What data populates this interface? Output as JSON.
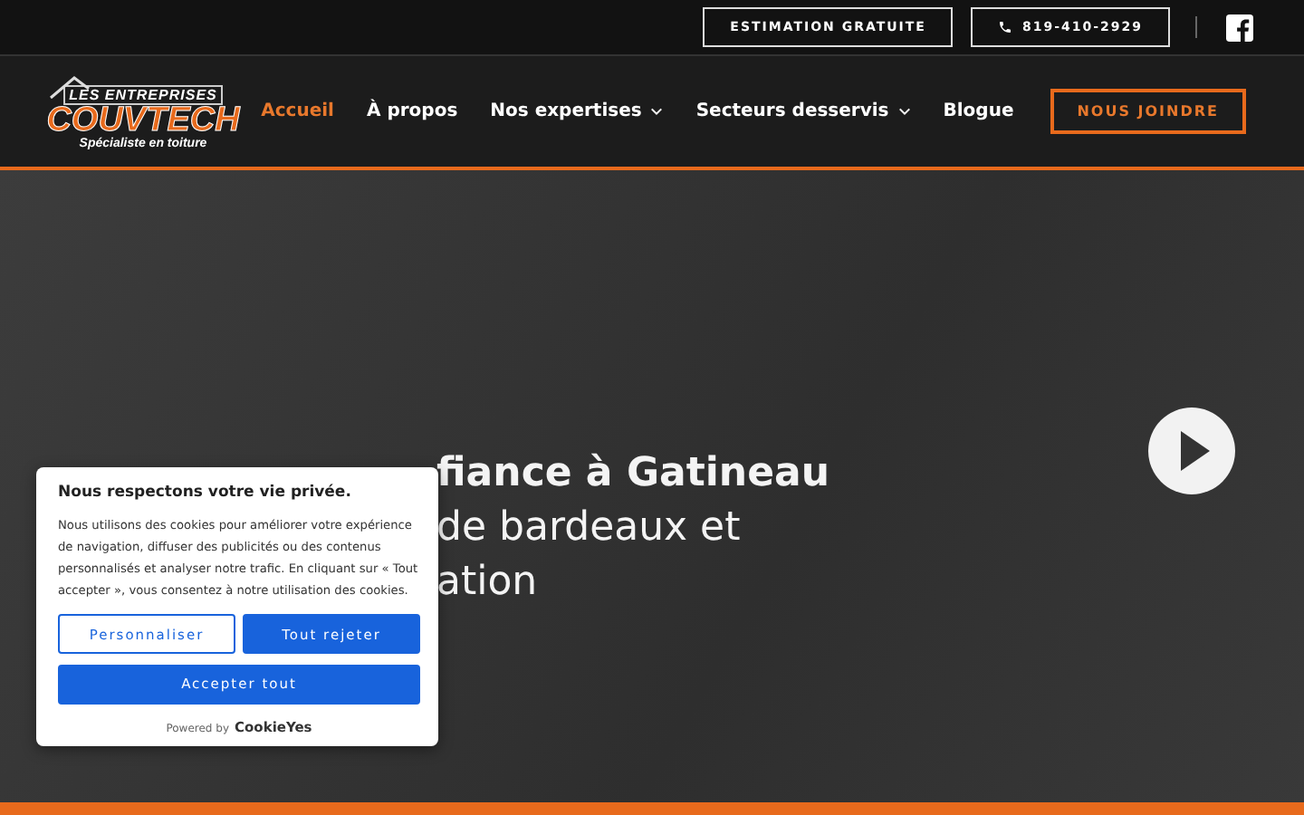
{
  "top_bar": {
    "estimate_button": "ESTIMATION GRATUITE",
    "phone_button": "819-410-2929"
  },
  "logo": {
    "line_1": "LES ENTREPRISES",
    "brand": "COUVTECH",
    "tagline": "Spécialiste en toiture"
  },
  "nav": {
    "items": [
      {
        "label": "Accueil",
        "selected": true,
        "dropdown": false
      },
      {
        "label": "À propos",
        "selected": false,
        "dropdown": false
      },
      {
        "label": "Nos expertises",
        "selected": false,
        "dropdown": true
      },
      {
        "label": "Secteurs desservis",
        "selected": false,
        "dropdown": true
      },
      {
        "label": "Blogue",
        "selected": false,
        "dropdown": false
      }
    ],
    "contact_button": "NOUS JOINDRE"
  },
  "hero": {
    "heading_lines": [
      "fiance à Gatineau",
      "de bardeaux et",
      "ation"
    ]
  },
  "cookie_banner": {
    "title": "Nous respectons votre vie privée.",
    "text": "Nous utilisons des cookies pour améliorer votre expérience de navigation, diffuser des publicités ou des contenus personnalisés et analyser notre trafic. En cliquant sur « Tout accepter », vous consentez à notre utilisation des cookies.",
    "customize_button": "Personnaliser",
    "reject_button": "Tout rejeter",
    "accept_button": "Accepter tout",
    "powered_by": "Powered by",
    "provider": "CookieYes"
  }
}
